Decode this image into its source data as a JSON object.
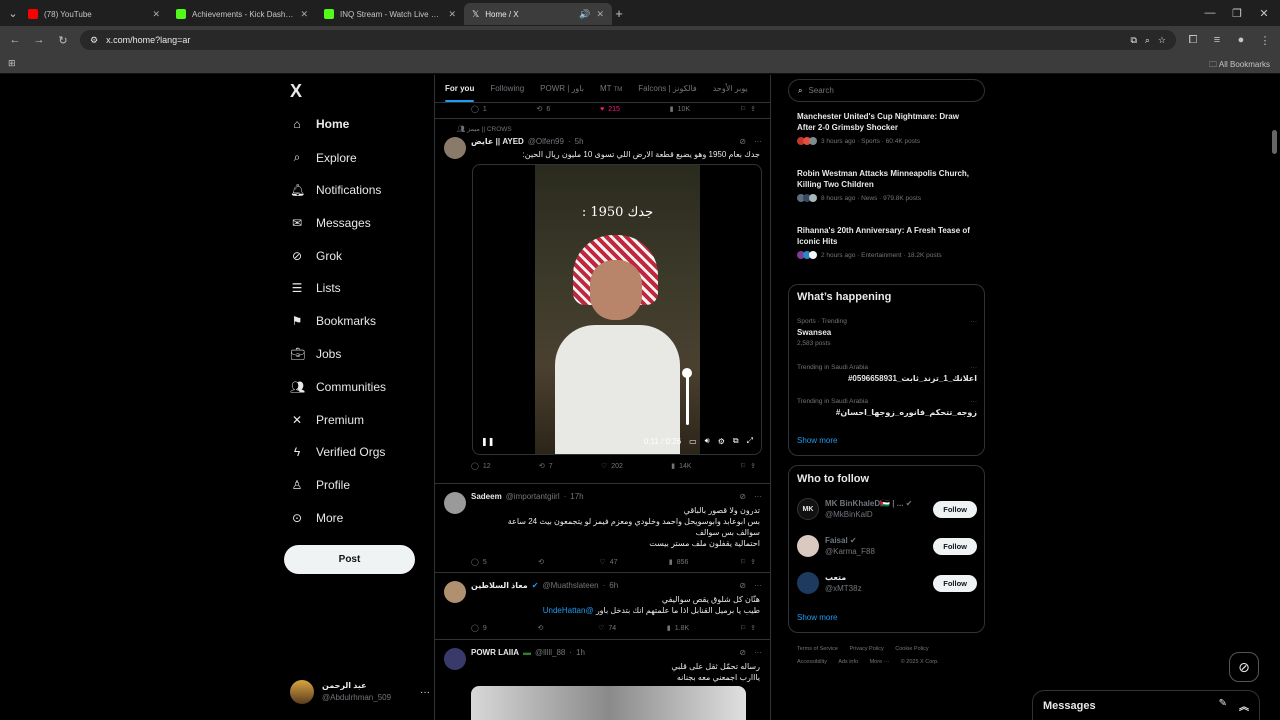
{
  "browser": {
    "tabs": [
      {
        "label": "(78) YouTube",
        "color": "#ff0000"
      },
      {
        "label": "Achievements - Kick Dashboard",
        "color": "#53fc18"
      },
      {
        "label": "INQ Stream - Watch Live on Kick",
        "color": "#53fc18"
      },
      {
        "label": "Home / X",
        "color": "#ffffff"
      }
    ],
    "url": "x.com/home?lang=ar",
    "all_bookmarks": "All Bookmarks"
  },
  "sidebar": {
    "logo": "X",
    "items": [
      {
        "label": "Home",
        "icon": "home-icon"
      },
      {
        "label": "Explore",
        "icon": "search-icon"
      },
      {
        "label": "Notifications",
        "icon": "bell-icon"
      },
      {
        "label": "Messages",
        "icon": "mail-icon"
      },
      {
        "label": "Grok",
        "icon": "grok-icon"
      },
      {
        "label": "Lists",
        "icon": "list-icon"
      },
      {
        "label": "Bookmarks",
        "icon": "bookmark-icon"
      },
      {
        "label": "Jobs",
        "icon": "briefcase-icon"
      },
      {
        "label": "Communities",
        "icon": "people-icon"
      },
      {
        "label": "Premium",
        "icon": "x-icon"
      },
      {
        "label": "Verified Orgs",
        "icon": "lightning-icon"
      },
      {
        "label": "Profile",
        "icon": "person-icon"
      },
      {
        "label": "More",
        "icon": "more-circle-icon"
      }
    ],
    "post_label": "Post",
    "account": {
      "name": "عبد الرحمن",
      "handle": "@Abdulrhman_509"
    }
  },
  "feed": {
    "tabs": [
      "For you",
      "Following",
      "POWR | باور",
      "MT",
      "Falcons | فالكونز",
      "يوبر الأوحد"
    ],
    "tab_mt_suffix": "TM",
    "top_actions": {
      "reply": "1",
      "repost": "6",
      "like": "215",
      "views": "10K"
    },
    "posts": [
      {
        "social_context": "ميمز || CROWS",
        "name": "عايض || AYED",
        "handle": "@Olfen99",
        "time": "5h",
        "text": "جدك بعام 1950 وهو يضيع قطعة الارض اللي تسوى 10 مليون ريال الحين:",
        "video_caption": "جدك 1950 :",
        "video_time": "0:11 / 0:26",
        "actions": {
          "reply": "12",
          "repost": "7",
          "like": "202",
          "views": "14K"
        }
      },
      {
        "name": "Sadeem",
        "handle": "@importantgiirl",
        "time": "17h",
        "lines": [
          "تدرون ولا قصور بالباقي",
          "بس ابوعابد وابوسويحل واحمد وخلودي ومعزم فيمز لو يتجمعون بيث 24 ساعة",
          "سوالف بس سوالف",
          "احتمالية يقفلون ملف مستر بيست"
        ],
        "actions": {
          "reply": "5",
          "repost": "",
          "like": "47",
          "views": "856"
        }
      },
      {
        "name": "معاذ السلاطين",
        "handle": "@Muathslateen",
        "time": "6h",
        "lines": [
          "هنّان كل شلوق يقص سواليفي",
          "طيب يا برميل القنابل اذا ما علمتهم انك بتدخل باور"
        ],
        "mention": "@UndeHattan",
        "actions": {
          "reply": "9",
          "repost": "",
          "like": "74",
          "views": "1.8K"
        }
      },
      {
        "name": "POWR LAIIA",
        "handle": "@lllll_88",
        "time": "1h",
        "lines": [
          "رساله تحمّل ثقل على قلبي",
          "يااارب اجمعني معه بجنانه"
        ]
      }
    ]
  },
  "right": {
    "search_placeholder": "Search",
    "news": [
      {
        "title": "Manchester United's Cup Nightmare: Draw After 2-0 Grimsby Shocker",
        "meta": "3 hours ago · Sports · 60.4K posts"
      },
      {
        "title": "Robin Westman Attacks Minneapolis Church, Killing Two Children",
        "meta": "8 hours ago · News · 979.8K posts"
      },
      {
        "title": "Rihanna's 20th Anniversary: A Fresh Tease of Iconic Hits",
        "meta": "2 hours ago · Entertainment · 18.2K posts"
      }
    ],
    "whats_happening": {
      "title": "What’s happening",
      "trends": [
        {
          "meta": "Sports · Trending",
          "title": "Swansea",
          "count": "2,583 posts"
        },
        {
          "meta": "Trending in Saudi Arabia",
          "title": "#اعلانك_1_ترند_ثابت_0596658931",
          "count": ""
        },
        {
          "meta": "Trending in Saudi Arabia",
          "title": "#زوجه_تتحكم_فانوره_زوجها_احسان",
          "count": ""
        }
      ],
      "show_more": "Show more"
    },
    "who_to_follow": {
      "title": "Who to follow",
      "users": [
        {
          "name": "MK BinKhaleD🇵🇸 | ...",
          "handle": "@MkBinKalD",
          "avatar_text": "MK"
        },
        {
          "name": "Faisal",
          "handle": "@Karma_F88",
          "avatar_text": ""
        },
        {
          "name": "متعب",
          "handle": "@xMT38z",
          "avatar_text": ""
        }
      ],
      "follow_label": "Follow",
      "show_more": "Show more"
    },
    "footer": [
      "Terms of Service",
      "Privacy Policy",
      "Cookie Policy",
      "Accessibility",
      "Ads info",
      "More ···",
      "© 2025 X Corp."
    ]
  },
  "messages_dock": {
    "title": "Messages"
  }
}
